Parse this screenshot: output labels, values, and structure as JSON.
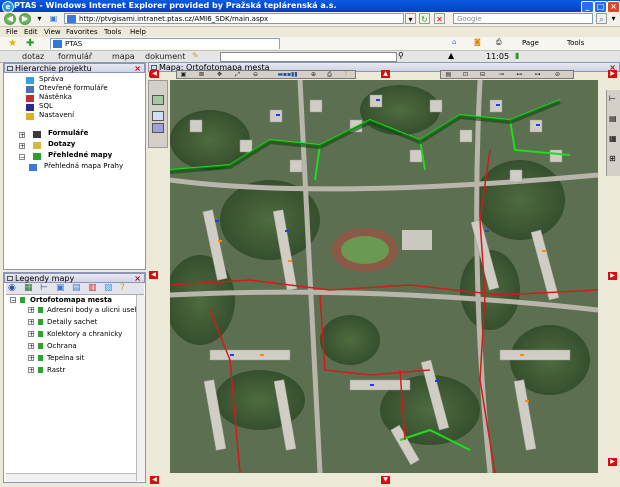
{
  "window": {
    "title": "PTAS - Windows Internet Explorer provided by Pražská teplárenská a.s."
  },
  "addressbar": {
    "url": "http://ptvgisami.intranet.ptas.cz/AMI6_SDK/main.aspx",
    "search_placeholder": "Google"
  },
  "menubar": {
    "items": [
      "File",
      "Edit",
      "View",
      "Favorites",
      "Tools",
      "Help"
    ]
  },
  "favbar": {
    "tab_title": "PTAS",
    "page_label": "Page",
    "tools_label": "Tools"
  },
  "appmenu": {
    "items": [
      "dotaz",
      "formulář",
      "mapa",
      "dokument"
    ],
    "clock": "11:05"
  },
  "left_panel": {
    "title": "Hierarchie projektu",
    "top_items": [
      "Správa",
      "Otevřené formuláře",
      "Nástěnka",
      "SQL",
      "Nastavení"
    ],
    "groups": [
      "Formuláře",
      "Dotazy",
      "Přehledné mapy"
    ],
    "sub_items": [
      "Přehledná mapa Prahy"
    ]
  },
  "legend_panel": {
    "title": "Legendy mapy",
    "root": "Ortofotomapa mesta",
    "layers": [
      "Adresni body a ulicni usek",
      "Detaily sachet",
      "Kolektory a chranicky",
      "Ochrana",
      "Tepelna sit",
      "Rastr"
    ]
  },
  "map": {
    "title": "Mapa: Ortofotomapa mesta"
  },
  "colors": {
    "title_bar": "#0a5ae0",
    "pipe_green": "#1edc1e",
    "pipe_red": "#d41a1a",
    "map_base": "#6b7860"
  }
}
